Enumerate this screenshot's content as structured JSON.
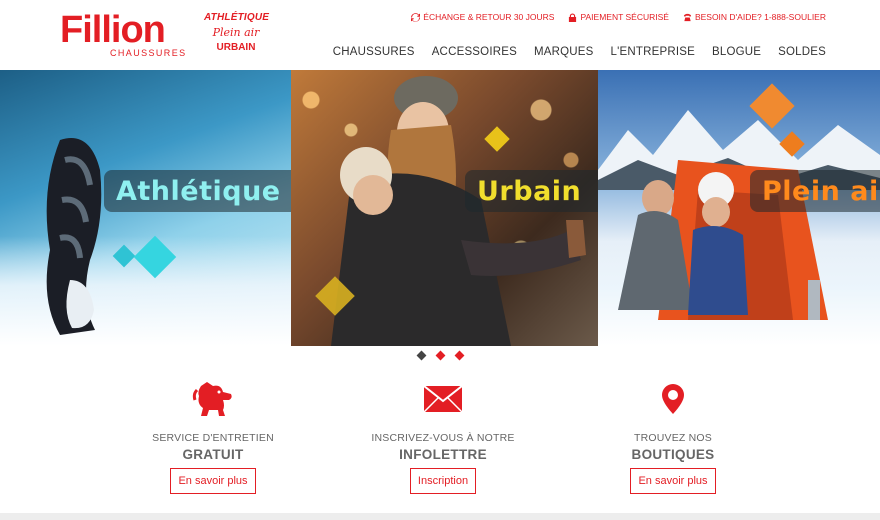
{
  "brand": {
    "name": "Fillion",
    "sub": "CHAUSSURES",
    "tagline": [
      "ATHLÉTIQUE",
      "Plein air",
      "URBAIN"
    ],
    "accent_color": "#e31e24"
  },
  "utility": [
    {
      "icon": "refresh-icon",
      "label": "ÉCHANGE & RETOUR 30 JOURS"
    },
    {
      "icon": "lock-icon",
      "label": "PAIEMENT SÉCURISÉ"
    },
    {
      "icon": "phone-icon",
      "label": "BESOIN D'AIDE? 1-888-SOULIER"
    }
  ],
  "nav": [
    "CHAUSSURES",
    "ACCESSOIRES",
    "MARQUES",
    "L'ENTREPRISE",
    "BLOGUE",
    "SOLDES"
  ],
  "hero": {
    "panels": [
      {
        "label": "Athlétique",
        "color": "#8ff0f0"
      },
      {
        "label": "Urbain",
        "color": "#f1de2d"
      },
      {
        "label": "Plein air",
        "color": "#ff8a1c"
      }
    ]
  },
  "dots": [
    {
      "color": "#444444",
      "active": false
    },
    {
      "color": "#e31e24",
      "active": true
    },
    {
      "color": "#e31e24",
      "active": false
    }
  ],
  "features": [
    {
      "icon": "dog-icon",
      "line1": "SERVICE D'ENTRETIEN",
      "line2": "GRATUIT",
      "button": "En savoir plus"
    },
    {
      "icon": "envelope-icon",
      "line1": "INSCRIVEZ-VOUS À NOTRE",
      "line2": "INFOLETTRE",
      "button": "Inscription"
    },
    {
      "icon": "map-pin-icon",
      "line1": "TROUVEZ NOS",
      "line2": "BOUTIQUES",
      "button": "En savoir plus"
    }
  ]
}
